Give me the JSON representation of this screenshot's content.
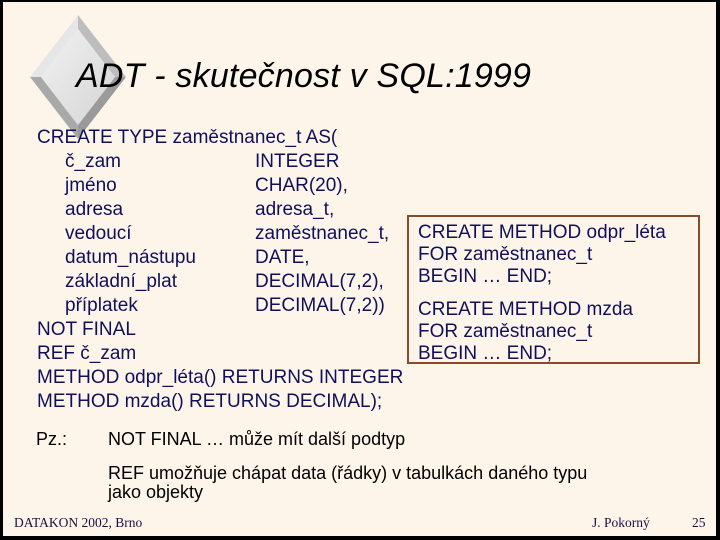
{
  "slide": {
    "title": "ADT - skutečnost v SQL:1999",
    "logo_icon": "beveled-diamond",
    "type_definition": {
      "header": "CREATE TYPE zaměstnanec_t AS(",
      "attributes": [
        {
          "name": "č_zam",
          "type": "INTEGER"
        },
        {
          "name": "jméno",
          "type": "CHAR(20),"
        },
        {
          "name": "adresa",
          "type": "adresa_t,"
        },
        {
          "name": "vedoucí",
          "type": "zaměstnanec_t,"
        },
        {
          "name": "datum_nástupu",
          "type": "DATE,"
        },
        {
          "name": "základní_plat",
          "type": "DECIMAL(7,2),"
        },
        {
          "name": "příplatek",
          "type": "DECIMAL(7,2))"
        }
      ],
      "trailer": [
        "NOT FINAL",
        "REF č_zam",
        "METHOD odpr_léta() RETURNS INTEGER",
        "METHOD mzda() RETURNS DECIMAL);"
      ]
    },
    "methods_box": {
      "method1": [
        "CREATE METHOD odpr_léta",
        "FOR zaměstnanec_t",
        "BEGIN … END;"
      ],
      "method2": [
        "CREATE METHOD mzda",
        "FOR zaměstnanec_t",
        "BEGIN … END;"
      ]
    },
    "notes": {
      "label": "Pz.:",
      "note1": "NOT FINAL … může mít další podtyp",
      "note2_line1": "REF umožňuje chápat data (řádky) v tabulkách daného typu",
      "note2_line2": "jako objekty"
    },
    "footer": {
      "left": "DATAKON 2002, Brno",
      "author": "J. Pokorný",
      "page_number": "25"
    },
    "colors": {
      "background": "#FEF5EA",
      "code_text": "#10105A",
      "box_border": "#8B4A2B",
      "frame": "#000000"
    }
  }
}
